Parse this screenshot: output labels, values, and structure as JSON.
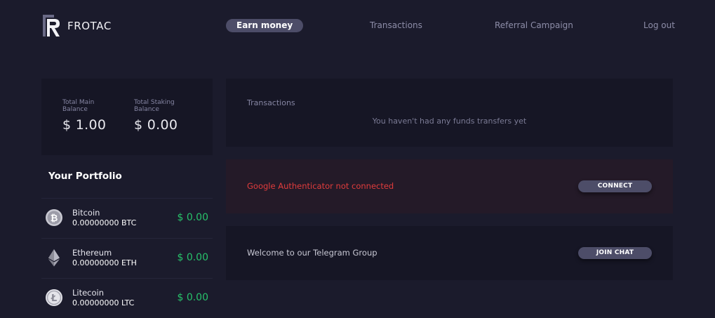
{
  "brand": {
    "name": "FROTAC"
  },
  "nav": {
    "earn": "Earn money",
    "transactions": "Transactions",
    "referral": "Referral Campaign",
    "logout": "Log out"
  },
  "balances": {
    "main_label": "Total Main Balance",
    "main_value": "$ 1.00",
    "staking_label": "Total Staking Balance",
    "staking_value": "$ 0.00"
  },
  "portfolio": {
    "title": "Your Portfolio",
    "assets": [
      {
        "name": "Bitcoin",
        "amount": "0.00000000 BTC",
        "value": "$ 0.00",
        "icon": "bitcoin-icon"
      },
      {
        "name": "Ethereum",
        "amount": "0.00000000 ETH",
        "value": "$ 0.00",
        "icon": "ethereum-icon"
      },
      {
        "name": "Litecoin",
        "amount": "0.00000000 LTC",
        "value": "$ 0.00",
        "icon": "litecoin-icon"
      }
    ]
  },
  "transactions_panel": {
    "title": "Transactions",
    "empty": "You haven't had any funds transfers yet"
  },
  "auth": {
    "message": "Google Authenticator not connected",
    "button": "CONNECT"
  },
  "telegram": {
    "message": "Welcome to our Telegram Group",
    "button": "JOIN CHAT"
  },
  "colors": {
    "background": "#1b1b2c",
    "panel": "#161625",
    "accent_pill": "#4d4d68",
    "positive": "#27c26b",
    "alert": "#e03c3c",
    "alert_panel": "#241a28"
  }
}
